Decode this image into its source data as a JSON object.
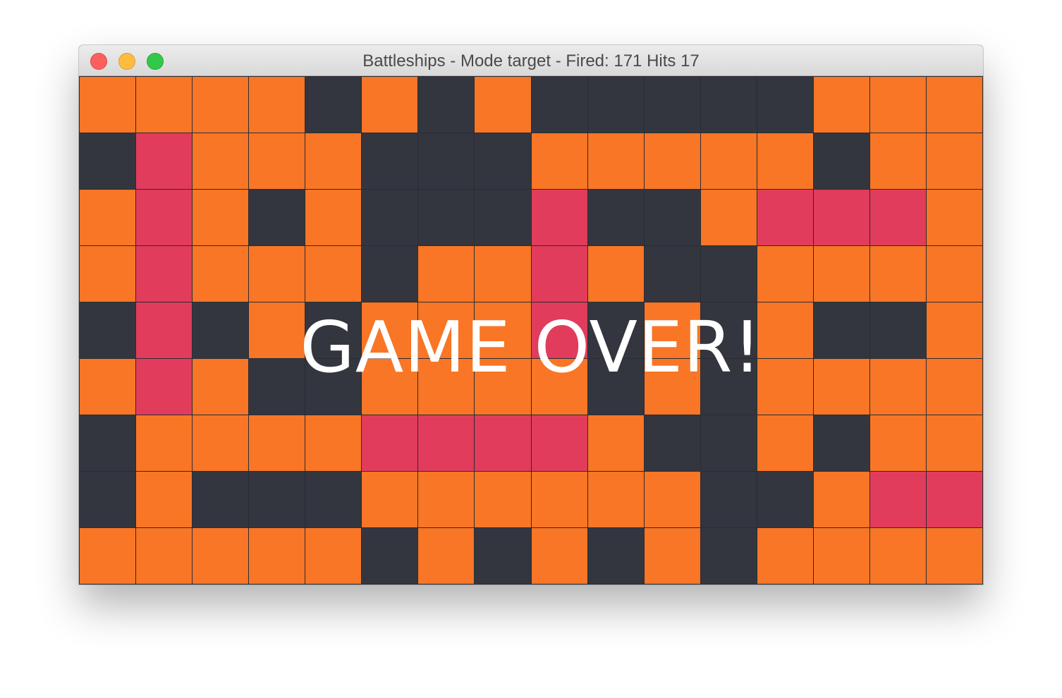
{
  "window": {
    "title": "Battleships - Mode target - Fired: 171 Hits 17"
  },
  "colors": {
    "miss": "#f87625",
    "unknown": "#33363f",
    "hit": "#e13c5c"
  },
  "board": {
    "rows": [
      [
        "miss",
        "miss",
        "miss",
        "miss",
        "unknown",
        "miss",
        "unknown",
        "miss",
        "unknown",
        "unknown",
        "unknown",
        "unknown",
        "unknown",
        "miss",
        "miss",
        "miss"
      ],
      [
        "unknown",
        "hit",
        "miss",
        "miss",
        "miss",
        "unknown",
        "unknown",
        "unknown",
        "miss",
        "miss",
        "miss",
        "miss",
        "miss",
        "unknown",
        "miss",
        "miss"
      ],
      [
        "miss",
        "hit",
        "miss",
        "unknown",
        "miss",
        "unknown",
        "unknown",
        "unknown",
        "hit",
        "unknown",
        "unknown",
        "miss",
        "hit",
        "hit",
        "hit",
        "miss"
      ],
      [
        "miss",
        "hit",
        "miss",
        "miss",
        "miss",
        "unknown",
        "miss",
        "miss",
        "hit",
        "miss",
        "unknown",
        "unknown",
        "miss",
        "miss",
        "miss",
        "miss"
      ],
      [
        "unknown",
        "hit",
        "unknown",
        "miss",
        "unknown",
        "miss",
        "miss",
        "miss",
        "hit",
        "unknown",
        "miss",
        "unknown",
        "miss",
        "unknown",
        "unknown",
        "miss"
      ],
      [
        "miss",
        "hit",
        "miss",
        "unknown",
        "unknown",
        "miss",
        "miss",
        "miss",
        "miss",
        "unknown",
        "miss",
        "unknown",
        "miss",
        "miss",
        "miss",
        "miss"
      ],
      [
        "unknown",
        "miss",
        "miss",
        "miss",
        "miss",
        "hit",
        "hit",
        "hit",
        "hit",
        "miss",
        "unknown",
        "unknown",
        "miss",
        "unknown",
        "miss",
        "miss"
      ],
      [
        "unknown",
        "miss",
        "unknown",
        "unknown",
        "unknown",
        "miss",
        "miss",
        "miss",
        "miss",
        "miss",
        "miss",
        "unknown",
        "unknown",
        "miss",
        "hit",
        "hit"
      ],
      [
        "miss",
        "miss",
        "miss",
        "miss",
        "miss",
        "unknown",
        "miss",
        "unknown",
        "miss",
        "unknown",
        "miss",
        "unknown",
        "miss",
        "miss",
        "miss",
        "miss"
      ]
    ]
  },
  "overlay": {
    "message": "GAME OVER!"
  }
}
